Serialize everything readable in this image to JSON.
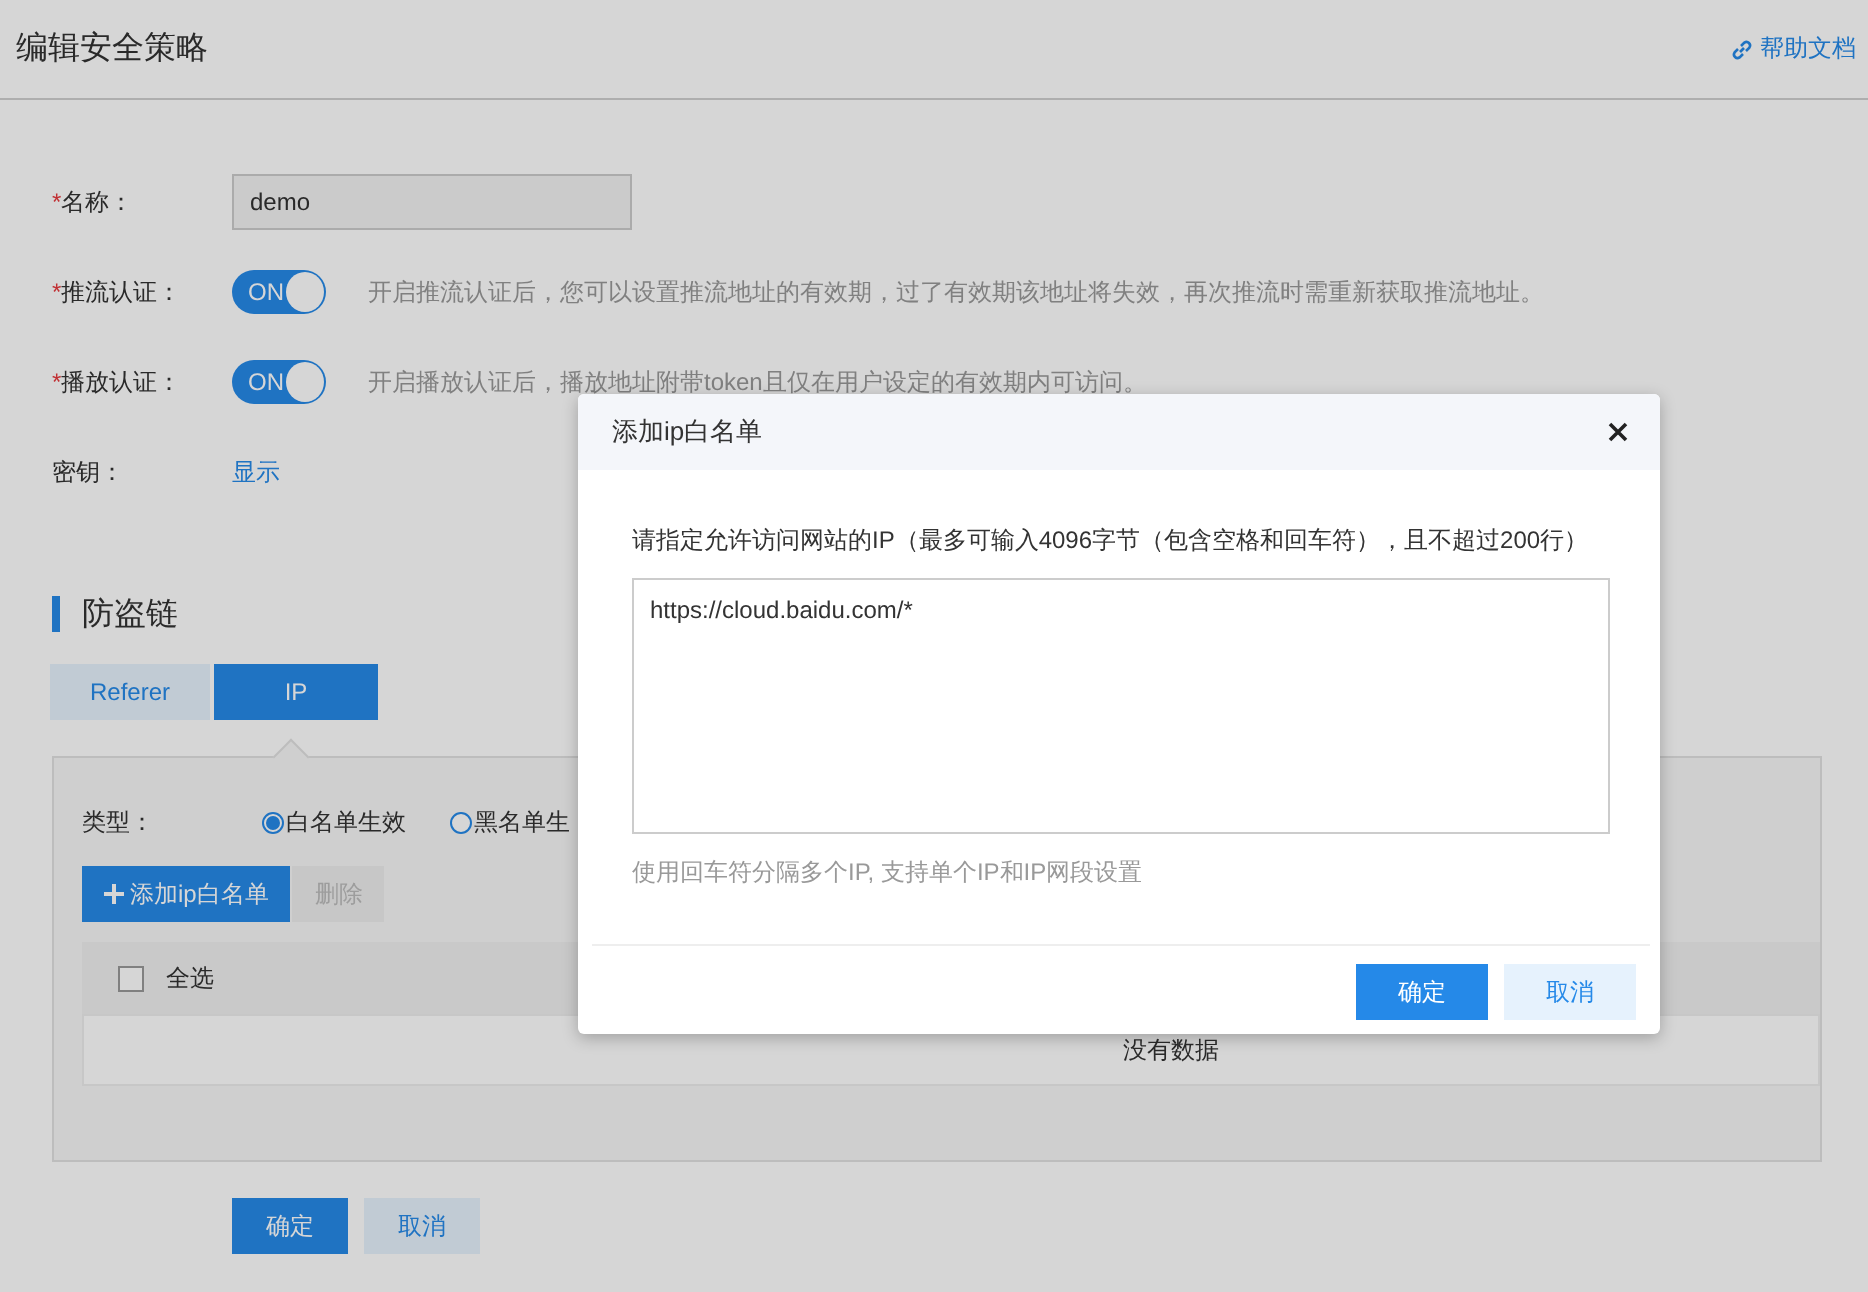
{
  "header": {
    "title": "编辑安全策略",
    "help_link": "帮助文档"
  },
  "form": {
    "rows": [
      {
        "kind": "input",
        "mark": "*",
        "label": "名称：",
        "value": "demo"
      },
      {
        "kind": "toggle",
        "mark": "*",
        "label": "推流认证：",
        "on": true,
        "toggle_text": "ON",
        "description": "开启推流认证后，您可以设置推流地址的有效期，过了有效期该地址将失效，再次推流时需重新获取推流地址。"
      },
      {
        "kind": "toggle",
        "mark": "*",
        "label": "播放认证：",
        "on": true,
        "toggle_text": "ON",
        "description": "开启播放认证后，播放地址附带token且仅在用户设定的有效期内可访问。"
      },
      {
        "kind": "link",
        "label": "密钥：",
        "link": "显示"
      }
    ]
  },
  "anti_leech": {
    "title": "防盗链",
    "tabs": [
      {
        "label": "Referer",
        "selected": false
      },
      {
        "label": "IP",
        "selected": true
      }
    ],
    "type_label": "类型：",
    "radios": [
      {
        "label": "白名单生效",
        "selected": true
      },
      {
        "label": "黑名单生",
        "selected": false
      }
    ],
    "add_button": "添加ip白名单",
    "delete_button": {
      "label": "删除",
      "disabled": true
    },
    "table": {
      "select_all": {
        "label": "全选",
        "checked": false
      },
      "empty_text": "没有数据"
    }
  },
  "actions": [
    {
      "label": "确定",
      "kind": "primary"
    },
    {
      "label": "取消",
      "kind": "secondary"
    }
  ],
  "modal": {
    "title": "添加ip白名单",
    "instruction": "请指定允许访问网站的IP（最多可输入4096字节（包含空格和回车符），且不超过200行）",
    "value": "https://cloud.baidu.com/*",
    "hint": "使用回车符分隔多个IP, 支持单个IP和IP网段设置",
    "buttons": [
      {
        "label": "确定",
        "kind": "primary"
      },
      {
        "label": "取消",
        "kind": "secondary"
      }
    ]
  }
}
